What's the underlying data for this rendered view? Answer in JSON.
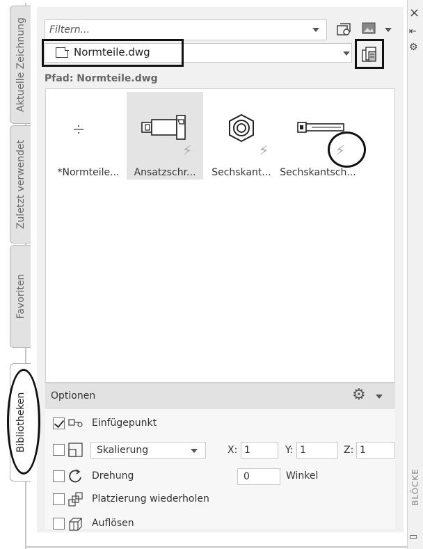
{
  "tabs": [
    {
      "label": "Aktuelle Zeichnung",
      "active": false
    },
    {
      "label": "Zuletzt verwendet",
      "active": false
    },
    {
      "label": "Favoriten",
      "active": false
    },
    {
      "label": "Bibliotheken",
      "active": true
    }
  ],
  "filter": {
    "placeholder": "Filtern..."
  },
  "file_select": {
    "value": "Normteile.dwg"
  },
  "path": {
    "label": "Pfad: Normteile.dwg"
  },
  "blocks": [
    {
      "label": "*Normteile...",
      "selected": false,
      "dynamic": false
    },
    {
      "label": "Ansatzschr...",
      "selected": true,
      "dynamic": true
    },
    {
      "label": "Sechskant...",
      "selected": false,
      "dynamic": true
    },
    {
      "label": "Sechskantsch...",
      "selected": false,
      "dynamic": true
    }
  ],
  "options": {
    "title": "Optionen",
    "insertion_point": {
      "label": "Einfügepunkt",
      "checked": true
    },
    "scale": {
      "value": "Skalierung",
      "checked": false,
      "x_label": "X:",
      "x": "1",
      "y_label": "Y:",
      "y": "1",
      "z_label": "Z:",
      "z": "1"
    },
    "rotation": {
      "label": "Drehung",
      "checked": false,
      "angle": "0",
      "angle_label": "Winkel"
    },
    "repeat": {
      "label": "Platzierung wiederholen",
      "checked": false
    },
    "explode": {
      "label": "Auflösen",
      "checked": false
    }
  },
  "side_strip": {
    "close_glyph": "×",
    "title": "BLÖCKE"
  },
  "colors": {
    "panel_bg": "#f1f1f1",
    "selected_bg": "#e4e4e4",
    "dynamic_bolt": "#a8a8a8"
  }
}
